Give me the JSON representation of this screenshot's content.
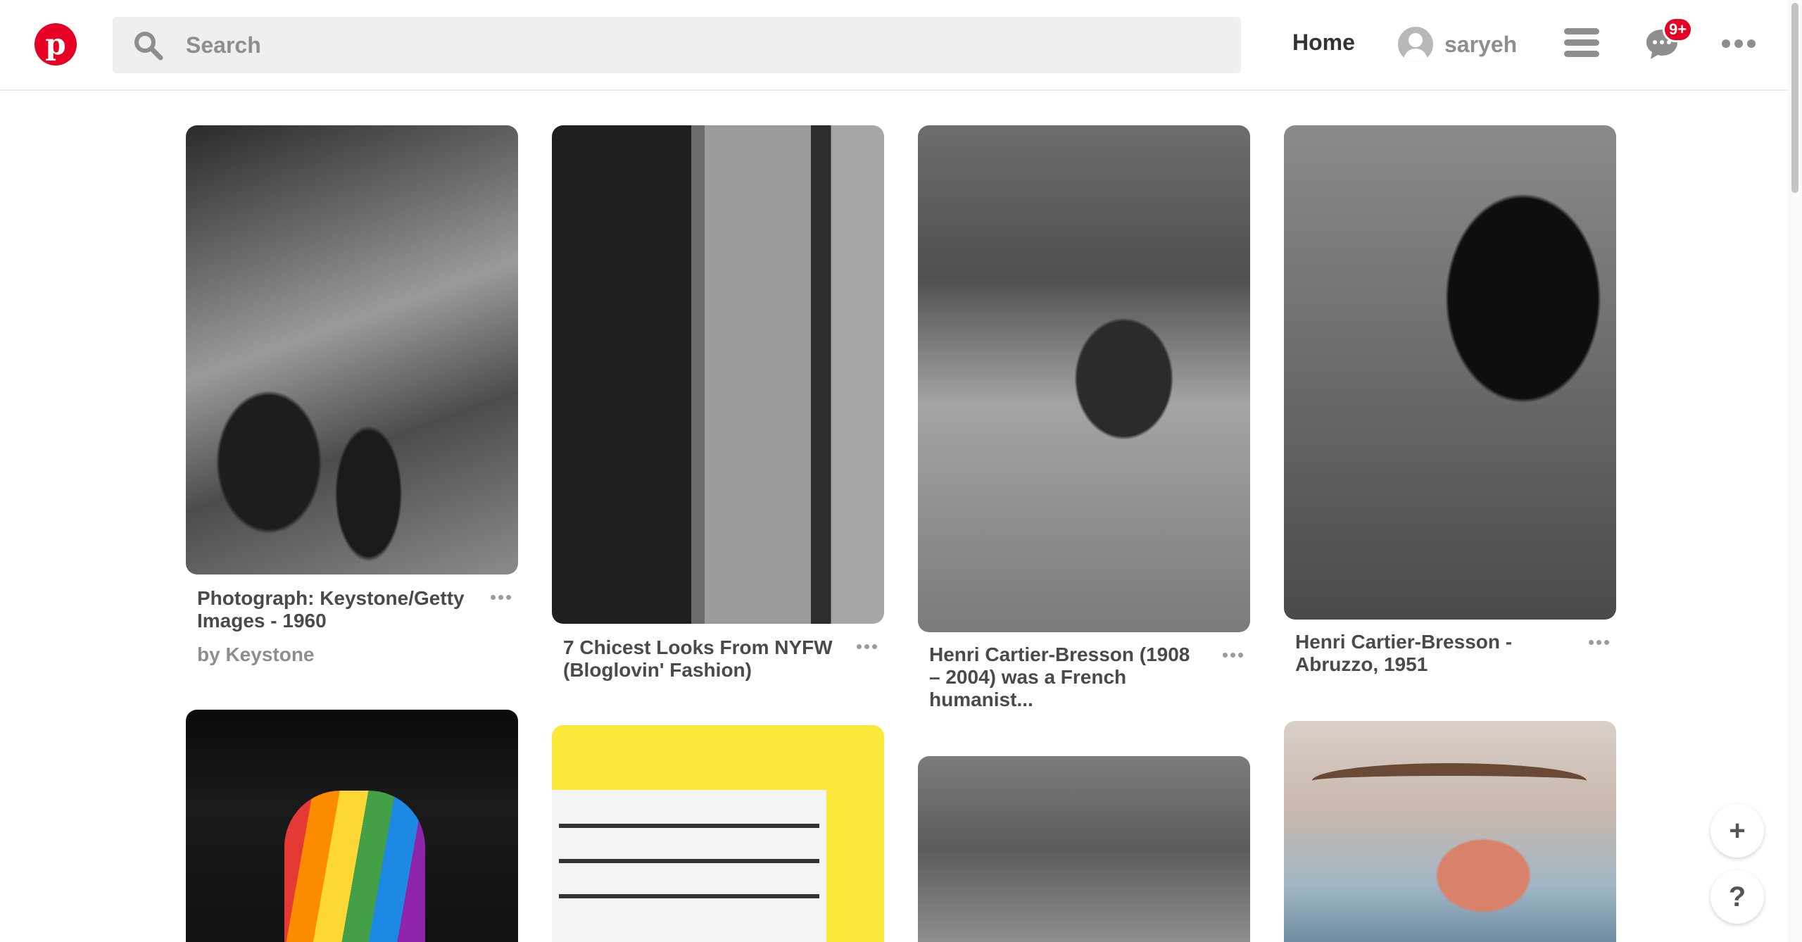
{
  "header": {
    "search_placeholder": "Search",
    "home_label": "Home",
    "username": "saryeh",
    "notification_badge": "9+"
  },
  "pins": [
    {
      "title": "Photograph: Keystone/Getty Images - 1960",
      "by": "by Keystone"
    },
    {
      "title": "7 Chicest Looks From NYFW (Bloglovin' Fashion)"
    },
    {
      "title": "Henri Cartier-Bresson (1908 – 2004) was a French humanist..."
    },
    {
      "title": "Henri Cartier-Bresson - Abruzzo, 1951"
    }
  ],
  "fab": {
    "add_glyph": "+",
    "help_glyph": "?"
  },
  "colors": {
    "brand": "#e60023",
    "text": "#4a4a4a",
    "muted": "#8e8e8e"
  }
}
